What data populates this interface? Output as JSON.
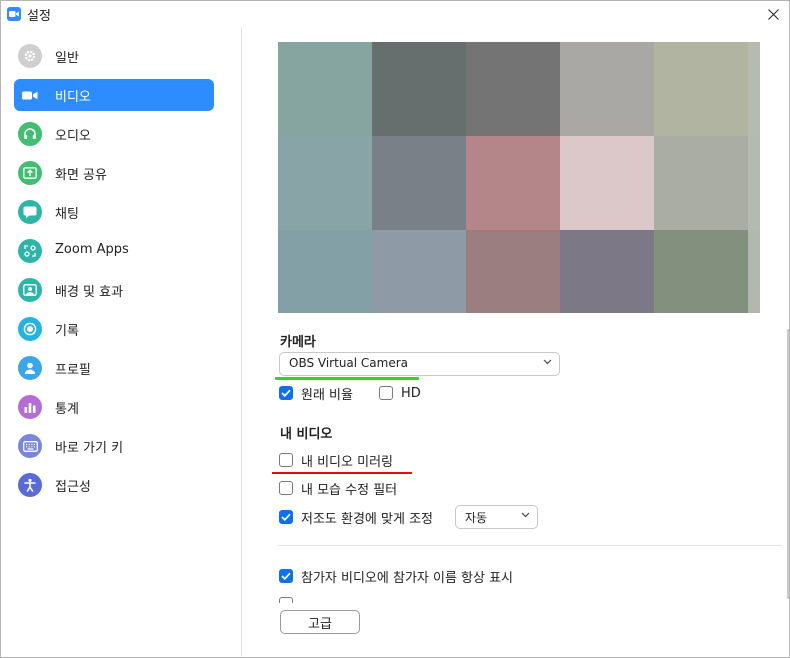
{
  "window": {
    "title": "설정"
  },
  "sidebar": {
    "items": [
      {
        "label": "일반",
        "icon": "gear-icon",
        "color": "#c9c9c9"
      },
      {
        "label": "비디오",
        "icon": "video-camera-icon",
        "color": "#2d8cff",
        "active": true
      },
      {
        "label": "오디오",
        "icon": "headphones-icon",
        "color": "#3fbf6f"
      },
      {
        "label": "화면 공유",
        "icon": "share-screen-icon",
        "color": "#3fbf6f"
      },
      {
        "label": "채팅",
        "icon": "chat-bubble-icon",
        "color": "#2fb5a8"
      },
      {
        "label": "Zoom Apps",
        "icon": "apps-icon",
        "color": "#2fb5a8"
      },
      {
        "label": "배경 및 효과",
        "icon": "background-icon",
        "color": "#2fb5a8"
      },
      {
        "label": "기록",
        "icon": "record-icon",
        "color": "#26b3e0"
      },
      {
        "label": "프로필",
        "icon": "profile-icon",
        "color": "#3aa7e8"
      },
      {
        "label": "통계",
        "icon": "statistics-icon",
        "color": "#b46dd6"
      },
      {
        "label": "바로 가기 키",
        "icon": "keyboard-icon",
        "color": "#7a86d9"
      },
      {
        "label": "접근성",
        "icon": "accessibility-icon",
        "color": "#5a6ad6"
      }
    ]
  },
  "video": {
    "preview_colors": [
      "#86a4a0",
      "#666e6e",
      "#747474",
      "#aaa8a4",
      "#b2b4a2",
      "#b7bab0",
      "#88a4a6",
      "#7a8088",
      "#b4868a",
      "#dcc8c8",
      "#aaada4",
      "#b6b9b0",
      "#82a0a6",
      "#8e9aa6",
      "#9a7e80",
      "#7c7886",
      "#84907e",
      "#b4b7ae"
    ],
    "camera_section": "카메라",
    "camera_value": "OBS Virtual Camera",
    "original_ratio_label": "원래 비율",
    "original_ratio_checked": true,
    "hd_label": "HD",
    "hd_checked": false,
    "my_video_section": "내 비디오",
    "mirror_label": "내 비디오 미러링",
    "mirror_checked": false,
    "touch_up_label": "내 모습 수정 필터",
    "touch_up_checked": false,
    "low_light_label": "저조도 환경에 맞게 조정",
    "low_light_checked": true,
    "low_light_value": "자동",
    "always_show_names_label": "참가자 비디오에 참가자 이름 항상 표시",
    "always_show_names_checked": true,
    "advanced_label": "고급",
    "colors": {
      "accent": "#2d8cff",
      "checkbox": "#0e71eb",
      "highlight_green": "#3ad12b",
      "highlight_red": "#e01010"
    }
  }
}
